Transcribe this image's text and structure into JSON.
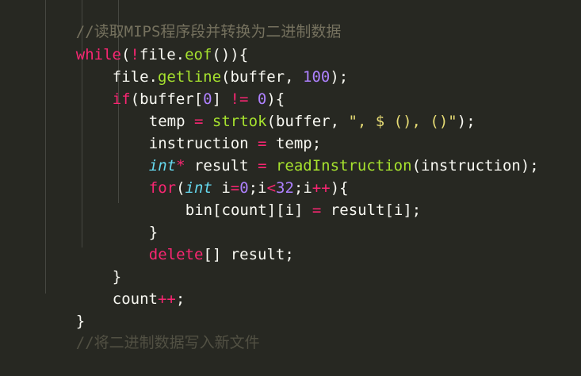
{
  "code": {
    "comment_top": "//读取MIPS程序段并转换为二进制数据",
    "while_kw": "while",
    "while_cond_a": "(",
    "while_not": "!",
    "while_cond_b": "file.",
    "while_fn": "eof",
    "while_cond_c": "()){",
    "l2_a": "file.",
    "l2_fn": "getline",
    "l2_b": "(buffer, ",
    "l2_num": "100",
    "l2_c": ");",
    "l3_kw": "if",
    "l3_a": "(buffer[",
    "l3_num0": "0",
    "l3_b": "] ",
    "l3_op": "!=",
    "l3_c": " ",
    "l3_num1": "0",
    "l3_d": "){",
    "l4_a": "temp ",
    "l4_op": "=",
    "l4_b": " ",
    "l4_fn": "strtok",
    "l4_c": "(buffer, ",
    "l4_str": "\", $ (), ()\"",
    "l4_d": ");",
    "l5_a": "instruction ",
    "l5_op": "=",
    "l5_b": " temp;",
    "l6_type": "int",
    "l6_star": "*",
    "l6_a": " result ",
    "l6_op": "=",
    "l6_b": " ",
    "l6_fn": "readInstruction",
    "l6_c": "(instruction);",
    "l7_kw": "for",
    "l7_a": "(",
    "l7_type": "int",
    "l7_b": " i",
    "l7_op1": "=",
    "l7_num0": "0",
    "l7_c": ";i",
    "l7_op2": "<",
    "l7_num1": "32",
    "l7_d": ";i",
    "l7_op3": "++",
    "l7_e": "){",
    "l8_a": "bin[count][i] ",
    "l8_op": "=",
    "l8_b": " result[i];",
    "l9": "}",
    "l10_kw": "delete",
    "l10_a": "[] result;",
    "l11": "}",
    "l12_a": "count",
    "l12_op": "++",
    "l12_b": ";",
    "l13": "}",
    "comment_bottom": "//将二进制数据写入新文件"
  },
  "colors": {
    "background": "#272822",
    "text": "#f8f8f2",
    "keyword": "#f92672",
    "function": "#a6e22e",
    "number": "#ae81ff",
    "string": "#e6db74",
    "comment": "#75715e",
    "type": "#66d9ef"
  }
}
